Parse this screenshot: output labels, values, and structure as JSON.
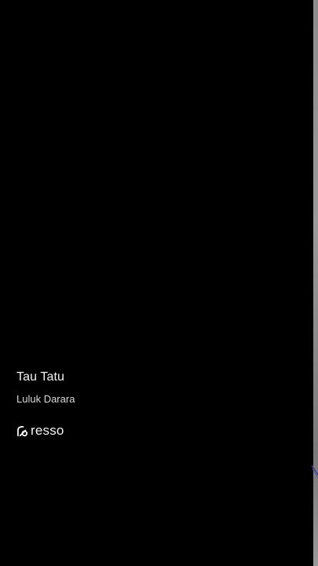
{
  "track": {
    "title": "Tau Tatu",
    "artist": "Luluk Darara"
  },
  "brand": {
    "name": "resso",
    "icon": "resso-logo-icon"
  },
  "colors": {
    "background": "#000000",
    "text": "#f2f2f2",
    "edge": "#8d8d8d"
  }
}
